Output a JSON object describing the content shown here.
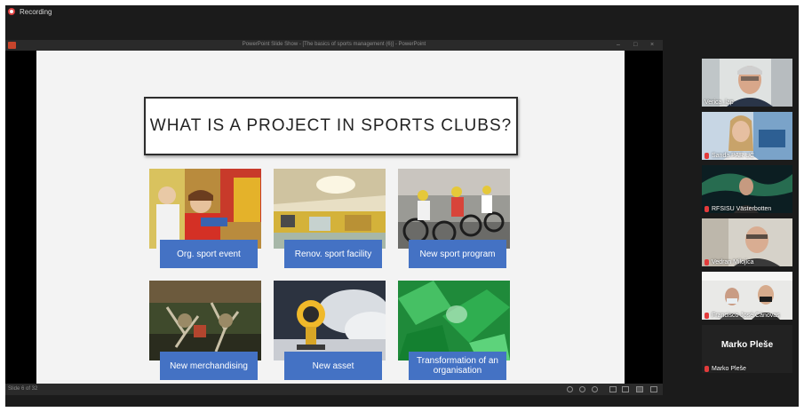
{
  "recording": {
    "label": "Recording"
  },
  "ppt": {
    "window_title": "PowerPoint Slide Show  -  [The basics of sports management (6)]  -  PowerPoint",
    "controls": {
      "minimize": "–",
      "maximize": "□",
      "close": "×"
    },
    "status": {
      "slide_counter": "Slide 6 of 32"
    }
  },
  "slide": {
    "title": "WHAT IS A PROJECT IN SPORTS CLUBS?",
    "tiles": [
      {
        "label": "Org. sport event"
      },
      {
        "label": "Renov. sport facility"
      },
      {
        "label": "New sport program"
      },
      {
        "label": "New merchandising"
      },
      {
        "label": "New asset"
      },
      {
        "label": "Transformation of an organisation"
      }
    ]
  },
  "participants": [
    {
      "name": "Verica_lap",
      "muted": false,
      "active": true
    },
    {
      "name": "Sanda PAR UC",
      "muted": true,
      "active": false
    },
    {
      "name": "RFSISU Västerbotten",
      "muted": true,
      "active": false
    },
    {
      "name": "Vedran Milojica",
      "muted": true,
      "active": false
    },
    {
      "name": "Francisco José Cánovas",
      "muted": true,
      "active": false
    },
    {
      "name": "Marko Pleše",
      "display_name": "Marko Pleše",
      "muted": true,
      "active": false
    }
  ],
  "colors": {
    "tag_blue": "#4472c4",
    "active_speaker": "#9ed65a",
    "muted_mic": "#e23b3b"
  }
}
